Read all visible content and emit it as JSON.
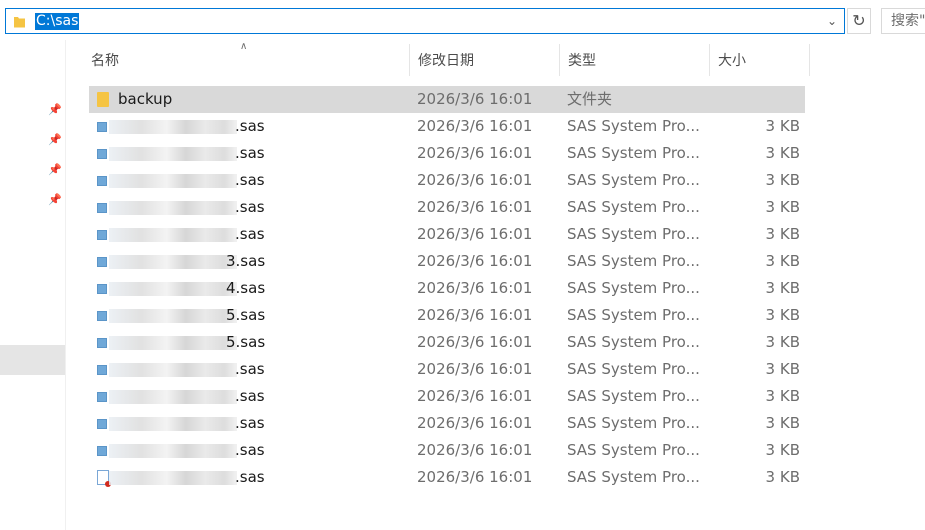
{
  "address_bar": {
    "path": "C:\\sas"
  },
  "search": {
    "placeholder": "搜索\""
  },
  "columns": [
    {
      "label": "名称"
    },
    {
      "label": "修改日期"
    },
    {
      "label": "类型"
    },
    {
      "label": "大小"
    }
  ],
  "rows": [
    {
      "name": "backup",
      "date": "2026/3/6 16:01",
      "type": "文件夹",
      "size": "",
      "icon": "folder-icon",
      "selected": true
    },
    {
      "name": ".sas",
      "date": "2026/3/6 16:01",
      "type": "SAS System Pro...",
      "size": "3 KB",
      "icon": "sas-file-icon"
    },
    {
      "name": ".sas",
      "date": "2026/3/6 16:01",
      "type": "SAS System Pro...",
      "size": "3 KB",
      "icon": "sas-file-icon"
    },
    {
      "name": ".sas",
      "date": "2026/3/6 16:01",
      "type": "SAS System Pro...",
      "size": "3 KB",
      "icon": "sas-file-icon"
    },
    {
      "name": ".sas",
      "date": "2026/3/6 16:01",
      "type": "SAS System Pro...",
      "size": "3 KB",
      "icon": "sas-file-icon"
    },
    {
      "name": ".sas",
      "date": "2026/3/6 16:01",
      "type": "SAS System Pro...",
      "size": "3 KB",
      "icon": "sas-file-icon"
    },
    {
      "name": "3.sas",
      "date": "2026/3/6 16:01",
      "type": "SAS System Pro...",
      "size": "3 KB",
      "icon": "sas-file-icon"
    },
    {
      "name": "4.sas",
      "date": "2026/3/6 16:01",
      "type": "SAS System Pro...",
      "size": "3 KB",
      "icon": "sas-file-icon"
    },
    {
      "name": "5.sas",
      "date": "2026/3/6 16:01",
      "type": "SAS System Pro...",
      "size": "3 KB",
      "icon": "sas-file-icon"
    },
    {
      "name": "5.sas",
      "date": "2026/3/6 16:01",
      "type": "SAS System Pro...",
      "size": "3 KB",
      "icon": "sas-file-icon"
    },
    {
      "name": ".sas",
      "date": "2026/3/6 16:01",
      "type": "SAS System Pro...",
      "size": "3 KB",
      "icon": "sas-file-icon"
    },
    {
      "name": ".sas",
      "date": "2026/3/6 16:01",
      "type": "SAS System Pro...",
      "size": "3 KB",
      "icon": "sas-file-icon"
    },
    {
      "name": ".sas",
      "date": "2026/3/6 16:01",
      "type": "SAS System Pro...",
      "size": "3 KB",
      "icon": "sas-file-icon"
    },
    {
      "name": ".sas",
      "date": "2026/3/6 16:01",
      "type": "SAS System Pro...",
      "size": "3 KB",
      "icon": "sas-file-icon"
    },
    {
      "name": ".sas",
      "date": "2026/3/6 16:01",
      "type": "SAS System Pro...",
      "size": "3 KB",
      "icon": "sas-program-icon"
    }
  ],
  "colors": {
    "accent": "#0078d7",
    "selection": "#d9d9d9",
    "muted_text": "#6d6d6d"
  }
}
